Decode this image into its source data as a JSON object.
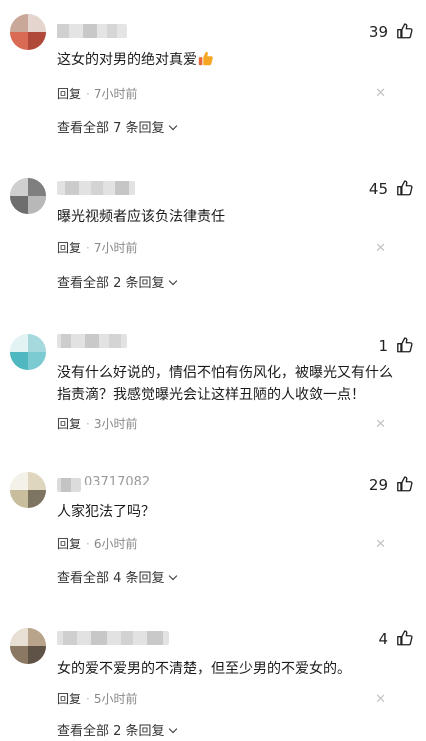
{
  "comments": [
    {
      "likes": "39",
      "text": "这女的对男的绝对真爱",
      "emoji": "thumbs-up-emoji",
      "reply_label": "回复",
      "time": "7小时前",
      "view_all": "查看全部 7 条回复"
    },
    {
      "likes": "45",
      "text": "曝光视频者应该负法律责任",
      "reply_label": "回复",
      "time": "7小时前",
      "view_all": "查看全部 2 条回复"
    },
    {
      "likes": "1",
      "text": "没有什么好说的，情侣不怕有伤风化，被曝光又有什么指责滴？我感觉曝光会让这样丑陋的人收敛一点！",
      "reply_label": "回复",
      "time": "3小时前"
    },
    {
      "likes": "29",
      "name_fragment": "03717082",
      "text": "人家犯法了吗？",
      "reply_label": "回复",
      "time": "6小时前",
      "view_all": "查看全部 4 条回复"
    },
    {
      "likes": "4",
      "text": "女的爱不爱男的不清楚，但至少男的不爱女的。",
      "reply_label": "回复",
      "time": "5小时前",
      "view_all": "查看全部 2 条回复"
    }
  ],
  "icons": {
    "like": "thumbs-up-outline-icon",
    "close": "close-icon",
    "expand": "chevron-down-icon"
  },
  "colors": {
    "text": "#1a1a1a",
    "meta": "#888888",
    "close": "#c4c4c4"
  }
}
